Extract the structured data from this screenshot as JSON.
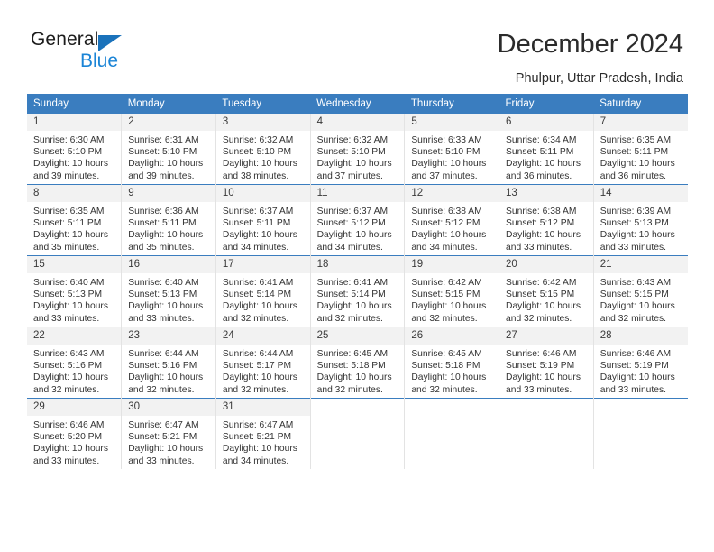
{
  "brand": {
    "name_dark": "General",
    "name_blue": "Blue",
    "accent_color": "#1a84d6",
    "triangle_color": "#1a72bb"
  },
  "header": {
    "title": "December 2024",
    "subtitle": "Phulpur, Uttar Pradesh, India"
  },
  "calendar": {
    "header_bg": "#3a7dbf",
    "daynum_bg": "#f2f2f2",
    "weekday_headers": [
      "Sunday",
      "Monday",
      "Tuesday",
      "Wednesday",
      "Thursday",
      "Friday",
      "Saturday"
    ],
    "weeks": [
      [
        {
          "day": "1",
          "sunrise": "Sunrise: 6:30 AM",
          "sunset": "Sunset: 5:10 PM",
          "daylight": "Daylight: 10 hours and 39 minutes."
        },
        {
          "day": "2",
          "sunrise": "Sunrise: 6:31 AM",
          "sunset": "Sunset: 5:10 PM",
          "daylight": "Daylight: 10 hours and 39 minutes."
        },
        {
          "day": "3",
          "sunrise": "Sunrise: 6:32 AM",
          "sunset": "Sunset: 5:10 PM",
          "daylight": "Daylight: 10 hours and 38 minutes."
        },
        {
          "day": "4",
          "sunrise": "Sunrise: 6:32 AM",
          "sunset": "Sunset: 5:10 PM",
          "daylight": "Daylight: 10 hours and 37 minutes."
        },
        {
          "day": "5",
          "sunrise": "Sunrise: 6:33 AM",
          "sunset": "Sunset: 5:10 PM",
          "daylight": "Daylight: 10 hours and 37 minutes."
        },
        {
          "day": "6",
          "sunrise": "Sunrise: 6:34 AM",
          "sunset": "Sunset: 5:11 PM",
          "daylight": "Daylight: 10 hours and 36 minutes."
        },
        {
          "day": "7",
          "sunrise": "Sunrise: 6:35 AM",
          "sunset": "Sunset: 5:11 PM",
          "daylight": "Daylight: 10 hours and 36 minutes."
        }
      ],
      [
        {
          "day": "8",
          "sunrise": "Sunrise: 6:35 AM",
          "sunset": "Sunset: 5:11 PM",
          "daylight": "Daylight: 10 hours and 35 minutes."
        },
        {
          "day": "9",
          "sunrise": "Sunrise: 6:36 AM",
          "sunset": "Sunset: 5:11 PM",
          "daylight": "Daylight: 10 hours and 35 minutes."
        },
        {
          "day": "10",
          "sunrise": "Sunrise: 6:37 AM",
          "sunset": "Sunset: 5:11 PM",
          "daylight": "Daylight: 10 hours and 34 minutes."
        },
        {
          "day": "11",
          "sunrise": "Sunrise: 6:37 AM",
          "sunset": "Sunset: 5:12 PM",
          "daylight": "Daylight: 10 hours and 34 minutes."
        },
        {
          "day": "12",
          "sunrise": "Sunrise: 6:38 AM",
          "sunset": "Sunset: 5:12 PM",
          "daylight": "Daylight: 10 hours and 34 minutes."
        },
        {
          "day": "13",
          "sunrise": "Sunrise: 6:38 AM",
          "sunset": "Sunset: 5:12 PM",
          "daylight": "Daylight: 10 hours and 33 minutes."
        },
        {
          "day": "14",
          "sunrise": "Sunrise: 6:39 AM",
          "sunset": "Sunset: 5:13 PM",
          "daylight": "Daylight: 10 hours and 33 minutes."
        }
      ],
      [
        {
          "day": "15",
          "sunrise": "Sunrise: 6:40 AM",
          "sunset": "Sunset: 5:13 PM",
          "daylight": "Daylight: 10 hours and 33 minutes."
        },
        {
          "day": "16",
          "sunrise": "Sunrise: 6:40 AM",
          "sunset": "Sunset: 5:13 PM",
          "daylight": "Daylight: 10 hours and 33 minutes."
        },
        {
          "day": "17",
          "sunrise": "Sunrise: 6:41 AM",
          "sunset": "Sunset: 5:14 PM",
          "daylight": "Daylight: 10 hours and 32 minutes."
        },
        {
          "day": "18",
          "sunrise": "Sunrise: 6:41 AM",
          "sunset": "Sunset: 5:14 PM",
          "daylight": "Daylight: 10 hours and 32 minutes."
        },
        {
          "day": "19",
          "sunrise": "Sunrise: 6:42 AM",
          "sunset": "Sunset: 5:15 PM",
          "daylight": "Daylight: 10 hours and 32 minutes."
        },
        {
          "day": "20",
          "sunrise": "Sunrise: 6:42 AM",
          "sunset": "Sunset: 5:15 PM",
          "daylight": "Daylight: 10 hours and 32 minutes."
        },
        {
          "day": "21",
          "sunrise": "Sunrise: 6:43 AM",
          "sunset": "Sunset: 5:15 PM",
          "daylight": "Daylight: 10 hours and 32 minutes."
        }
      ],
      [
        {
          "day": "22",
          "sunrise": "Sunrise: 6:43 AM",
          "sunset": "Sunset: 5:16 PM",
          "daylight": "Daylight: 10 hours and 32 minutes."
        },
        {
          "day": "23",
          "sunrise": "Sunrise: 6:44 AM",
          "sunset": "Sunset: 5:16 PM",
          "daylight": "Daylight: 10 hours and 32 minutes."
        },
        {
          "day": "24",
          "sunrise": "Sunrise: 6:44 AM",
          "sunset": "Sunset: 5:17 PM",
          "daylight": "Daylight: 10 hours and 32 minutes."
        },
        {
          "day": "25",
          "sunrise": "Sunrise: 6:45 AM",
          "sunset": "Sunset: 5:18 PM",
          "daylight": "Daylight: 10 hours and 32 minutes."
        },
        {
          "day": "26",
          "sunrise": "Sunrise: 6:45 AM",
          "sunset": "Sunset: 5:18 PM",
          "daylight": "Daylight: 10 hours and 32 minutes."
        },
        {
          "day": "27",
          "sunrise": "Sunrise: 6:46 AM",
          "sunset": "Sunset: 5:19 PM",
          "daylight": "Daylight: 10 hours and 33 minutes."
        },
        {
          "day": "28",
          "sunrise": "Sunrise: 6:46 AM",
          "sunset": "Sunset: 5:19 PM",
          "daylight": "Daylight: 10 hours and 33 minutes."
        }
      ],
      [
        {
          "day": "29",
          "sunrise": "Sunrise: 6:46 AM",
          "sunset": "Sunset: 5:20 PM",
          "daylight": "Daylight: 10 hours and 33 minutes."
        },
        {
          "day": "30",
          "sunrise": "Sunrise: 6:47 AM",
          "sunset": "Sunset: 5:21 PM",
          "daylight": "Daylight: 10 hours and 33 minutes."
        },
        {
          "day": "31",
          "sunrise": "Sunrise: 6:47 AM",
          "sunset": "Sunset: 5:21 PM",
          "daylight": "Daylight: 10 hours and 34 minutes."
        },
        {
          "day": "",
          "sunrise": "",
          "sunset": "",
          "daylight": ""
        },
        {
          "day": "",
          "sunrise": "",
          "sunset": "",
          "daylight": ""
        },
        {
          "day": "",
          "sunrise": "",
          "sunset": "",
          "daylight": ""
        },
        {
          "day": "",
          "sunrise": "",
          "sunset": "",
          "daylight": ""
        }
      ]
    ]
  }
}
